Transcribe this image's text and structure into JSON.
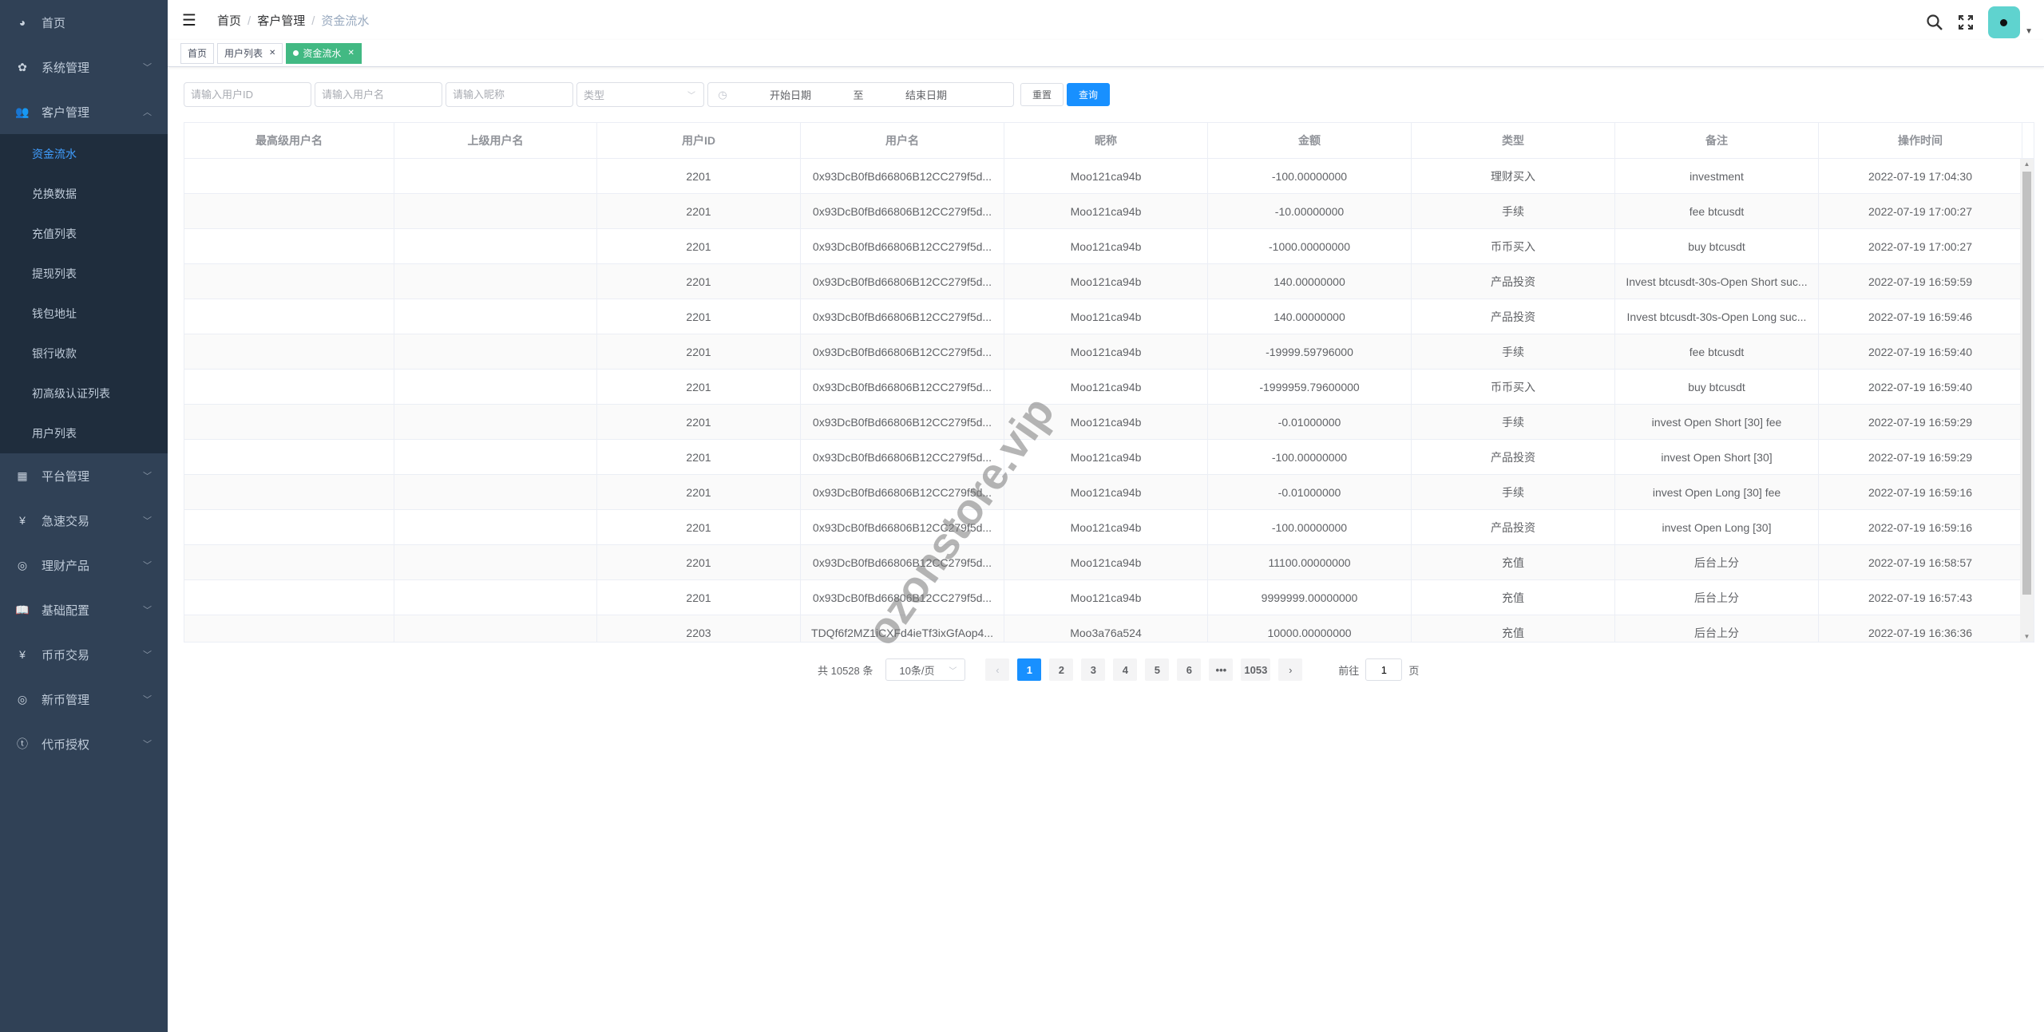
{
  "sidebar": {
    "items_top": [
      {
        "label": "首页",
        "icon": "dashboard-icon"
      },
      {
        "label": "系统管理",
        "icon": "gear-icon"
      },
      {
        "label": "客户管理",
        "icon": "users-icon"
      }
    ],
    "submenu": [
      "资金流水",
      "兑换数据",
      "充值列表",
      "提现列表",
      "钱包地址",
      "银行收款",
      "初高级认证列表",
      "用户列表"
    ],
    "active_sub": "资金流水",
    "items_bottom": [
      {
        "label": "平台管理",
        "icon": "grid-icon"
      },
      {
        "label": "急速交易",
        "icon": "yen-icon"
      },
      {
        "label": "理财产品",
        "icon": "lifebuoy-icon"
      },
      {
        "label": "基础配置",
        "icon": "book-icon"
      },
      {
        "label": "币币交易",
        "icon": "yen-icon"
      },
      {
        "label": "新币管理",
        "icon": "lifebuoy-icon"
      },
      {
        "label": "代币授权",
        "icon": "token-icon"
      }
    ]
  },
  "navbar": {
    "breadcrumb": [
      "首页",
      "客户管理",
      "资金流水"
    ]
  },
  "tags": [
    {
      "label": "首页",
      "closable": false,
      "active": false
    },
    {
      "label": "用户列表",
      "closable": true,
      "active": false
    },
    {
      "label": "资金流水",
      "closable": true,
      "active": true
    }
  ],
  "filters": {
    "user_id_placeholder": "请输入用户ID",
    "username_placeholder": "请输入用户名",
    "nickname_placeholder": "请输入昵称",
    "type_placeholder": "类型",
    "start_date": "开始日期",
    "range_sep": "至",
    "end_date": "结束日期",
    "reset": "重置",
    "search": "查询"
  },
  "table": {
    "columns": [
      "最高级用户名",
      "上级用户名",
      "用户ID",
      "用户名",
      "昵称",
      "金额",
      "类型",
      "备注",
      "操作时间"
    ],
    "rows": [
      [
        "",
        "",
        "2201",
        "0x93DcB0fBd66806B12CC279f5d...",
        "Moo121ca94b",
        "-100.00000000",
        "理财买入",
        "investment",
        "2022-07-19 17:04:30"
      ],
      [
        "",
        "",
        "2201",
        "0x93DcB0fBd66806B12CC279f5d...",
        "Moo121ca94b",
        "-10.00000000",
        "手续",
        "fee btcusdt",
        "2022-07-19 17:00:27"
      ],
      [
        "",
        "",
        "2201",
        "0x93DcB0fBd66806B12CC279f5d...",
        "Moo121ca94b",
        "-1000.00000000",
        "币币买入",
        "buy btcusdt",
        "2022-07-19 17:00:27"
      ],
      [
        "",
        "",
        "2201",
        "0x93DcB0fBd66806B12CC279f5d...",
        "Moo121ca94b",
        "140.00000000",
        "产品投资",
        "Invest btcusdt-30s-Open Short suc...",
        "2022-07-19 16:59:59"
      ],
      [
        "",
        "",
        "2201",
        "0x93DcB0fBd66806B12CC279f5d...",
        "Moo121ca94b",
        "140.00000000",
        "产品投资",
        "Invest btcusdt-30s-Open Long suc...",
        "2022-07-19 16:59:46"
      ],
      [
        "",
        "",
        "2201",
        "0x93DcB0fBd66806B12CC279f5d...",
        "Moo121ca94b",
        "-19999.59796000",
        "手续",
        "fee btcusdt",
        "2022-07-19 16:59:40"
      ],
      [
        "",
        "",
        "2201",
        "0x93DcB0fBd66806B12CC279f5d...",
        "Moo121ca94b",
        "-1999959.79600000",
        "币币买入",
        "buy btcusdt",
        "2022-07-19 16:59:40"
      ],
      [
        "",
        "",
        "2201",
        "0x93DcB0fBd66806B12CC279f5d...",
        "Moo121ca94b",
        "-0.01000000",
        "手续",
        "invest Open Short [30] fee",
        "2022-07-19 16:59:29"
      ],
      [
        "",
        "",
        "2201",
        "0x93DcB0fBd66806B12CC279f5d...",
        "Moo121ca94b",
        "-100.00000000",
        "产品投资",
        "invest Open Short [30]",
        "2022-07-19 16:59:29"
      ],
      [
        "",
        "",
        "2201",
        "0x93DcB0fBd66806B12CC279f5d...",
        "Moo121ca94b",
        "-0.01000000",
        "手续",
        "invest Open Long [30] fee",
        "2022-07-19 16:59:16"
      ],
      [
        "",
        "",
        "2201",
        "0x93DcB0fBd66806B12CC279f5d...",
        "Moo121ca94b",
        "-100.00000000",
        "产品投资",
        "invest Open Long [30]",
        "2022-07-19 16:59:16"
      ],
      [
        "",
        "",
        "2201",
        "0x93DcB0fBd66806B12CC279f5d...",
        "Moo121ca94b",
        "11100.00000000",
        "充值",
        "后台上分",
        "2022-07-19 16:58:57"
      ],
      [
        "",
        "",
        "2201",
        "0x93DcB0fBd66806B12CC279f5d...",
        "Moo121ca94b",
        "9999999.00000000",
        "充值",
        "后台上分",
        "2022-07-19 16:57:43"
      ],
      [
        "",
        "",
        "2203",
        "TDQf6f2MZ1iCXFd4ieTf3ixGfAop4...",
        "Moo3a76a524",
        "10000.00000000",
        "充值",
        "后台上分",
        "2022-07-19 16:36:36"
      ]
    ]
  },
  "pagination": {
    "total": "共 10528 条",
    "page_size": "10条/页",
    "pages": [
      "1",
      "2",
      "3",
      "4",
      "5",
      "6",
      "•••",
      "1053"
    ],
    "current": "1",
    "goto_label": "前往",
    "goto_value": "1",
    "goto_suffix": "页"
  },
  "watermark": "ozonstore.vip",
  "colors": {
    "sidebar_bg": "#304156",
    "submenu_bg": "#1f2d3d",
    "active_link": "#409eff",
    "primary": "#1890ff",
    "active_tag": "#42b983"
  }
}
